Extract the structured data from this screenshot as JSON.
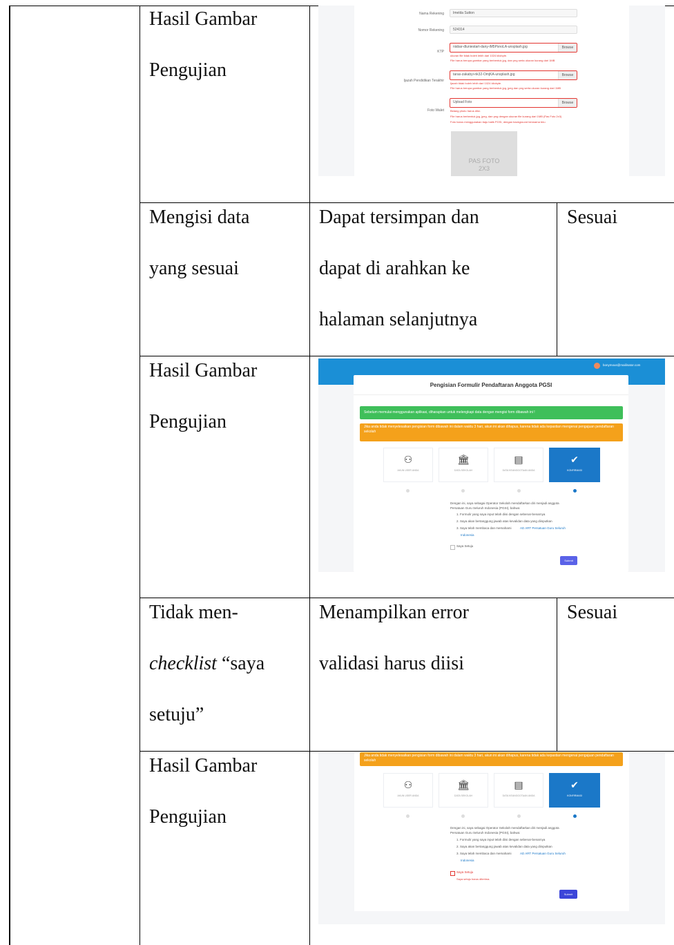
{
  "rows": {
    "r1": {
      "label": [
        "Hasil Gambar",
        "Pengujian"
      ]
    },
    "r2": {
      "label": [
        "Mengisi data",
        "yang sesuai"
      ],
      "result": [
        "Dapat tersimpan dan",
        "dapat di arahkan ke",
        "halaman selanjutnya"
      ],
      "status": "Sesuai"
    },
    "r3": {
      "label": [
        "Hasil Gambar",
        "Pengujian"
      ]
    },
    "r4": {
      "label_1": "Tidak men-",
      "label_2_italic": "checklist",
      "label_2_rest": " “saya",
      "label_3": "setuju”",
      "result": [
        "Menampilkan error",
        "validasi harus diisi"
      ],
      "status": "Sesuai"
    },
    "r5": {
      "label": [
        "Hasil Gambar",
        "Pengujian"
      ]
    }
  },
  "shot1": {
    "labels": [
      "Nama Rekening",
      "Nomor Rekening",
      "KTP",
      "Ijazah Pendidikan Terakhir",
      "Foto Walet"
    ],
    "nama_rekening": "Imelda Sutton",
    "nomor_rekening": "524314",
    "ktp_file": "nisbar-dluniestart-dany-iM5PsnoLA-unsplash.jpg",
    "ktp_errors": [
      "ukuran file tidak boleh lebih dari 1024 kilobyte.",
      "File harus berupa gambar yang berbentuk jpg, dan png serta ukuran kurang dari 1MB"
    ],
    "ijazah_file": "taras-zakabyi-nk32-OmjKA-unsplash.jpg",
    "ijazah_errors": [
      "Ijazah tidak boleh lebih dari 1024 kilobyte.",
      "File harus berupa gambar yang berbentuk jpg, jpeg dan png serta ukuran kurang dari 1MB"
    ],
    "foto_placeholder": "Upload Foto",
    "foto_errors": [
      "Bidang photo harus diisi.",
      "File harus berbentuk jpg, jpeg, dan png dengan ukuran file kurang dari 1MB (Pas Foto 2x3)",
      "Foto harus menggunakan baju batik PGSI, dengan background berwarna biru"
    ],
    "browse": "Browse",
    "pas_foto": [
      "PAS FOTO",
      "2X3"
    ]
  },
  "shot2": {
    "user": "bonymous@mailinator.com",
    "title": "Pengisian Formulir Pendaftaran Anggota PGSI",
    "green": "Sebelum memulai menggunakan aplikasi, diharapkan untuk melengkapi data dengan mengisi form dibawah ini !",
    "orange": "Jika anda tidak menyelesaikan pengisian form dibawah ini dalam waktu 3 hari, akun ini akan dihapus, karena tidak ada kepastian mengenai pengajuan pendaftaran sekolah",
    "steps": [
      "AKUN USER ANDA",
      "DATA SEKOLAH",
      "DATA KEANGGOTAAN ANDA",
      "KONFIRMASI"
    ],
    "dots": [
      "1",
      "2",
      "3",
      "4"
    ],
    "intro": [
      "Dengan ini, saya sebagai Operator Sekolah mendaftarkan diri menjadi anggota",
      "Persatuan Guru Seluruh Indonesia (PGSI), bahwa:"
    ],
    "list": [
      "1. Formulir yang saya input telah diisi dengan sebenar-benarnya",
      "2. Saya akan bertanggung jawab atas kevalidan data yang diinputkan",
      "3. Saya telah membaca dan memahami"
    ],
    "link": [
      "AD ART Persatuan Guru Seluruh",
      "Indonesia"
    ],
    "agree": "Saya Setuju",
    "submit": "Submit"
  },
  "shot3": {
    "error": "Saya setuju harus diterima."
  },
  "colors": {
    "green": "#3fbf5a",
    "orange": "#f4a11b",
    "blue": "#1b8fd6",
    "error": "#e3342f"
  }
}
